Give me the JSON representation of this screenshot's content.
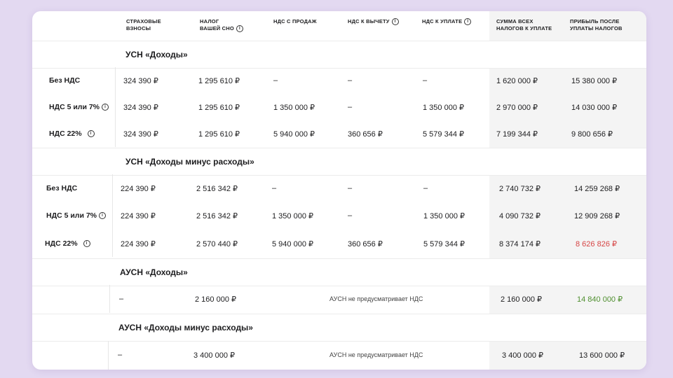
{
  "header": {
    "col1": "СТРАХОВЫЕ ВЗНОСЫ",
    "col1a": "СТРАХОВЫЕ",
    "col1b": "ВЗНОСЫ",
    "col2a": "НАЛОГ",
    "col2b": "ВАШЕЙ СНО",
    "col3": "НДС С ПРОДАЖ",
    "col4": "НДС К ВЫЧЕТУ",
    "col5": "НДС К УПЛАТЕ",
    "col6a": "СУММА ВСЕХ",
    "col6b": "НАЛОГОВ К УПЛАТЕ",
    "col7a": "ПРИБЫЛЬ ПОСЛЕ",
    "col7b": "УПЛАТЫ НАЛОГОВ",
    "info_glyph": "i"
  },
  "usn_income": {
    "title": "УСН «Доходы»",
    "rows": [
      {
        "label": "Без НДС",
        "vznosy": "324 390 ₽",
        "nalog": "1 295 610 ₽",
        "nds_sales": "–",
        "nds_deduct": "–",
        "nds_pay": "–",
        "total": "1 620 000 ₽",
        "profit": "15 380 000 ₽"
      },
      {
        "label": "НДС 5 или 7%",
        "vznosy": "324 390 ₽",
        "nalog": "1 295 610 ₽",
        "nds_sales": "1 350 000 ₽",
        "nds_deduct": "–",
        "nds_pay": "1 350 000 ₽",
        "total": "2 970 000 ₽",
        "profit": "14 030 000 ₽"
      },
      {
        "label": "НДС 22%",
        "vznosy": "324 390 ₽",
        "nalog": "1 295 610 ₽",
        "nds_sales": "5 940 000 ₽",
        "nds_deduct": "360 656 ₽",
        "nds_pay": "5 579 344 ₽",
        "total": "7 199 344 ₽",
        "profit": "9 800 656 ₽"
      }
    ]
  },
  "usn_income_minus": {
    "title": "УСН «Доходы минус расходы»",
    "rows": [
      {
        "label": "Без НДС",
        "vznosy": "224 390 ₽",
        "nalog": "2 516 342 ₽",
        "nds_sales": "–",
        "nds_deduct": "–",
        "nds_pay": "–",
        "total": "2 740 732 ₽",
        "profit": "14 259 268 ₽"
      },
      {
        "label": "НДС 5 или 7%",
        "vznosy": "224 390 ₽",
        "nalog": "2 516 342 ₽",
        "nds_sales": "1 350 000 ₽",
        "nds_deduct": "–",
        "nds_pay": "1 350 000 ₽",
        "total": "4 090 732 ₽",
        "profit": "12 909 268 ₽"
      },
      {
        "label": "НДС 22%",
        "vznosy": "224 390 ₽",
        "nalog": "2 570 440 ₽",
        "nds_sales": "5 940 000 ₽",
        "nds_deduct": "360 656 ₽",
        "nds_pay": "5 579 344 ₽",
        "total": "8 374 174 ₽",
        "profit": "8 626 826 ₽"
      }
    ]
  },
  "ausn_income": {
    "title": "АУСН «Доходы»",
    "vznosy": "–",
    "nalog": "2 160 000 ₽",
    "note": "АУСН не предусматривает НДС",
    "total": "2 160 000 ₽",
    "profit": "14 840 000 ₽"
  },
  "ausn_income_minus": {
    "title": "АУСН «Доходы минус расходы»",
    "vznosy": "–",
    "nalog": "3 400 000 ₽",
    "note": "АУСН не предусматривает НДС",
    "total": "3 400 000 ₽",
    "profit": "13 600 000 ₽"
  },
  "colors": {
    "background": "#e3d9f1",
    "loss_highlight": "#d64545",
    "gain_highlight": "#4f8f2f"
  }
}
